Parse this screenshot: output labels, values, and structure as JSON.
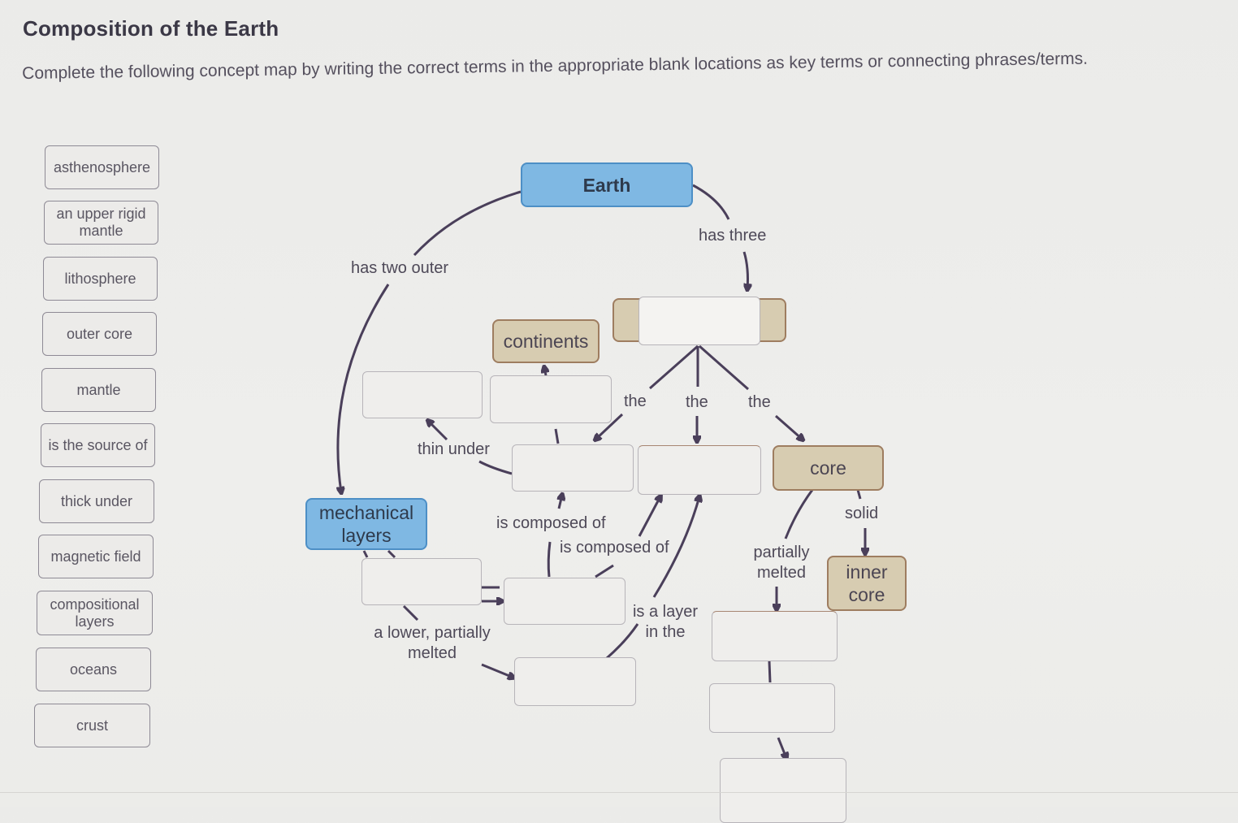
{
  "page": {
    "title": "Composition of the Earth",
    "instructions": "Complete the following concept map by writing the correct terms in the appropriate blank locations as key terms or connecting phrases/terms."
  },
  "word_bank": [
    {
      "label": "asthenosphere"
    },
    {
      "label": "an upper rigid mantle"
    },
    {
      "label": "lithosphere"
    },
    {
      "label": "outer core"
    },
    {
      "label": "mantle"
    },
    {
      "label": "is the source of"
    },
    {
      "label": "thick under"
    },
    {
      "label": "magnetic field"
    },
    {
      "label": "compositional layers"
    },
    {
      "label": "oceans"
    },
    {
      "label": "crust"
    }
  ],
  "concept_map": {
    "nodes": {
      "earth": "Earth",
      "continents": "continents",
      "mechanical_layers": "mechanical layers",
      "core": "core",
      "inner_core": "inner core"
    },
    "link_labels": {
      "has_two_outer": "has two outer",
      "has_three": "has three",
      "the_left": "the",
      "the_middle": "the",
      "the_right": "the",
      "thin_under": "thin under",
      "is_composed_of_1": "is composed of",
      "is_composed_of_2": "is composed of",
      "is_a_layer_in_the": "is a layer in the",
      "a_lower_partially_melted": "a lower, partially melted",
      "partially_melted": "partially melted",
      "solid": "solid"
    },
    "blank_slots": 11,
    "colors": {
      "blue_node": "#7fb8e3",
      "tan_node": "#d7ccb1",
      "link": "#4a3f5a"
    }
  }
}
